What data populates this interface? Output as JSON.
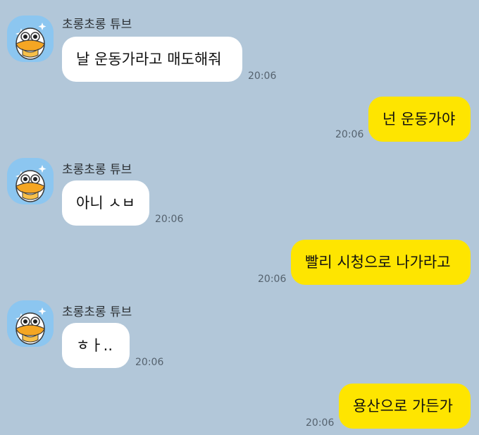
{
  "theme": {
    "background": "#b2c7d9",
    "incoming_bubble": "#ffffff",
    "outgoing_bubble": "#fee500",
    "avatar_bg": "#8cc6f0"
  },
  "messages": [
    {
      "direction": "in",
      "sender": "초롱초롱 튜브",
      "text": "날 운동가라고 매도해줘",
      "time": "20:06",
      "avatar_icon": "tube-duck-avatar-icon"
    },
    {
      "direction": "out",
      "text": "넌 운동가야",
      "time": "20:06"
    },
    {
      "direction": "in",
      "sender": "초롱초롱 튜브",
      "text": "아니 ㅅㅂ",
      "time": "20:06",
      "avatar_icon": "tube-duck-avatar-icon"
    },
    {
      "direction": "out",
      "text": "빨리 시청으로 나가라고",
      "time": "20:06"
    },
    {
      "direction": "in",
      "sender": "초롱초롱 튜브",
      "text": "ㅎㅏ..",
      "time": "20:06",
      "avatar_icon": "tube-duck-avatar-icon"
    },
    {
      "direction": "out",
      "text": "용산으로 가든가",
      "time": "20:06"
    }
  ]
}
